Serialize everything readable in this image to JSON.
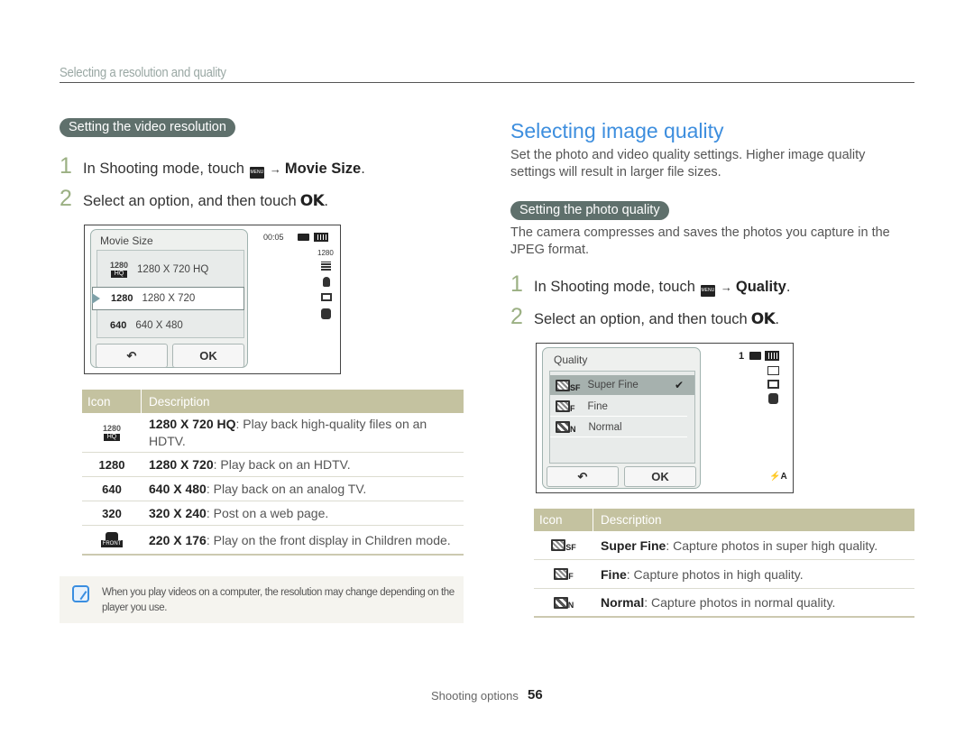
{
  "header": {
    "section_title": "Selecting a resolution and quality"
  },
  "left": {
    "pill": "Setting the video resolution",
    "steps": [
      {
        "num": "1",
        "text": "In Shooting mode, touch",
        "menu_icon": "MENU",
        "arrow": "→",
        "target": "Movie Size",
        "end": "."
      },
      {
        "num": "2",
        "text": "Select an option, and then touch",
        "ok": "OK",
        "end": "."
      }
    ],
    "screen": {
      "title": "Movie Size",
      "time": "00:05",
      "status_res": "1280",
      "items": [
        {
          "icon_top": "1280",
          "icon_badge": "HQ",
          "label": "1280 X 720 HQ",
          "selected": false
        },
        {
          "icon_top": "1280",
          "label": "1280 X 720",
          "selected": true
        },
        {
          "icon_top": "640",
          "label": "640 X 480",
          "selected": false
        }
      ],
      "back_label": "↶",
      "ok_label": "OK"
    },
    "table": {
      "col_icon": "Icon",
      "col_desc": "Description",
      "rows": [
        {
          "icon": "1280",
          "icon_badge": "HQ",
          "term": "1280 X 720 HQ",
          "desc": ": Play back high-quality files on an HDTV."
        },
        {
          "icon": "1280",
          "term": "1280 X 720",
          "desc": ": Play back on an HDTV."
        },
        {
          "icon": "640",
          "term": "640 X 480",
          "desc": ": Play back on an analog TV."
        },
        {
          "icon": "320",
          "term": "320 X 240",
          "desc": ": Post on a web page."
        },
        {
          "icon": "FRONT",
          "term": "220 X 176",
          "desc": ": Play on the front display in Children mode."
        }
      ]
    },
    "note": "When you play videos on a computer, the resolution may change depending on the player you use."
  },
  "right": {
    "title": "Selecting image quality",
    "intro": "Set the photo and video quality settings. Higher image quality settings will result in larger file sizes.",
    "pill": "Setting the photo quality",
    "pill_text": "The camera compresses and saves the photos you capture in the JPEG format.",
    "steps": [
      {
        "num": "1",
        "text": "In Shooting mode, touch",
        "menu_icon": "MENU",
        "arrow": "→",
        "target": "Quality",
        "end": "."
      },
      {
        "num": "2",
        "text": "Select an option, and then touch",
        "ok": "OK",
        "end": "."
      }
    ],
    "screen": {
      "title": "Quality",
      "shots_left": "1",
      "items": [
        {
          "suffix": "SF",
          "label": "Super Fine",
          "selected": true,
          "check": "✔"
        },
        {
          "suffix": "F",
          "label": "Fine",
          "selected": false
        },
        {
          "suffix": "N",
          "label": "Normal",
          "selected": false
        }
      ],
      "back_label": "↶",
      "ok_label": "OK",
      "flash": "⚡A"
    },
    "table": {
      "col_icon": "Icon",
      "col_desc": "Description",
      "rows": [
        {
          "suffix": "SF",
          "term": "Super Fine",
          "desc": ": Capture photos in super high quality."
        },
        {
          "suffix": "F",
          "term": "Fine",
          "desc": ": Capture photos in high quality."
        },
        {
          "suffix": "N",
          "term": "Normal",
          "desc": ": Capture photos in normal quality."
        }
      ]
    }
  },
  "footer": {
    "section": "Shooting options",
    "page": "56"
  }
}
